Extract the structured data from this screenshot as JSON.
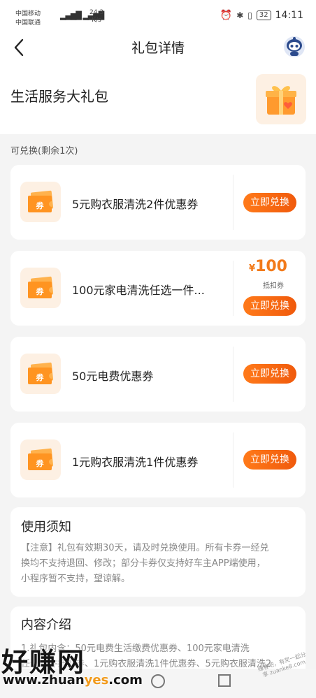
{
  "status_bar": {
    "carrier_1": "中国移动",
    "carrier_2": "中国联通",
    "net_speed_value": "24.3",
    "net_speed_unit": "K/s",
    "battery": "32",
    "time": "14:11"
  },
  "nav": {
    "title": "礼包详情",
    "back_icon": "chevron-left-icon",
    "avatar_icon": "robot-avatar-icon"
  },
  "header": {
    "title": "生活服务大礼包",
    "gift_icon": "gift-box-icon"
  },
  "section_label": "可兑换(剩余1次)",
  "coupons": [
    {
      "name": "5元购衣服清洗2件优惠券",
      "icon_label": "券",
      "button": "立即兑换"
    },
    {
      "name": "100元家电清洗任选一件...",
      "icon_label": "券",
      "price_symbol": "¥",
      "price_amount": "100",
      "price_label": "抵扣券",
      "button": "立即兑换"
    },
    {
      "name": "50元电费优惠券",
      "icon_label": "券",
      "button": "立即兑换"
    },
    {
      "name": "1元购衣服清洗1件优惠券",
      "icon_label": "券",
      "button": "立即兑换"
    }
  ],
  "notice": {
    "title": "使用须知",
    "lines": [
      "【注意】礼包有效期30天，请及时兑换使用。所有卡券一经兑",
      "换均不支持退回、修改；部分卡券仅支持好车主APP端使用，",
      "小程序暂不支持，望谅解。"
    ]
  },
  "intro": {
    "title": "内容介绍",
    "lines": [
      "1.礼包内含：50元电费生活缴费优惠券、100元家电清洗",
      "任选一件抵扣券、1元购衣服清洗1件优惠券、5元购衣服清洗2"
    ]
  },
  "watermark": {
    "main": "好赚网",
    "url_prefix": "www.zhuan",
    "url_highlight": "yes",
    "url_suffix": ".com",
    "corner": "赚客吧，有奖一起分享 zuanke8.com"
  },
  "colors": {
    "accent": "#f05a0c",
    "price": "#f27a1a",
    "icon_bg": "#fdf0e3"
  }
}
